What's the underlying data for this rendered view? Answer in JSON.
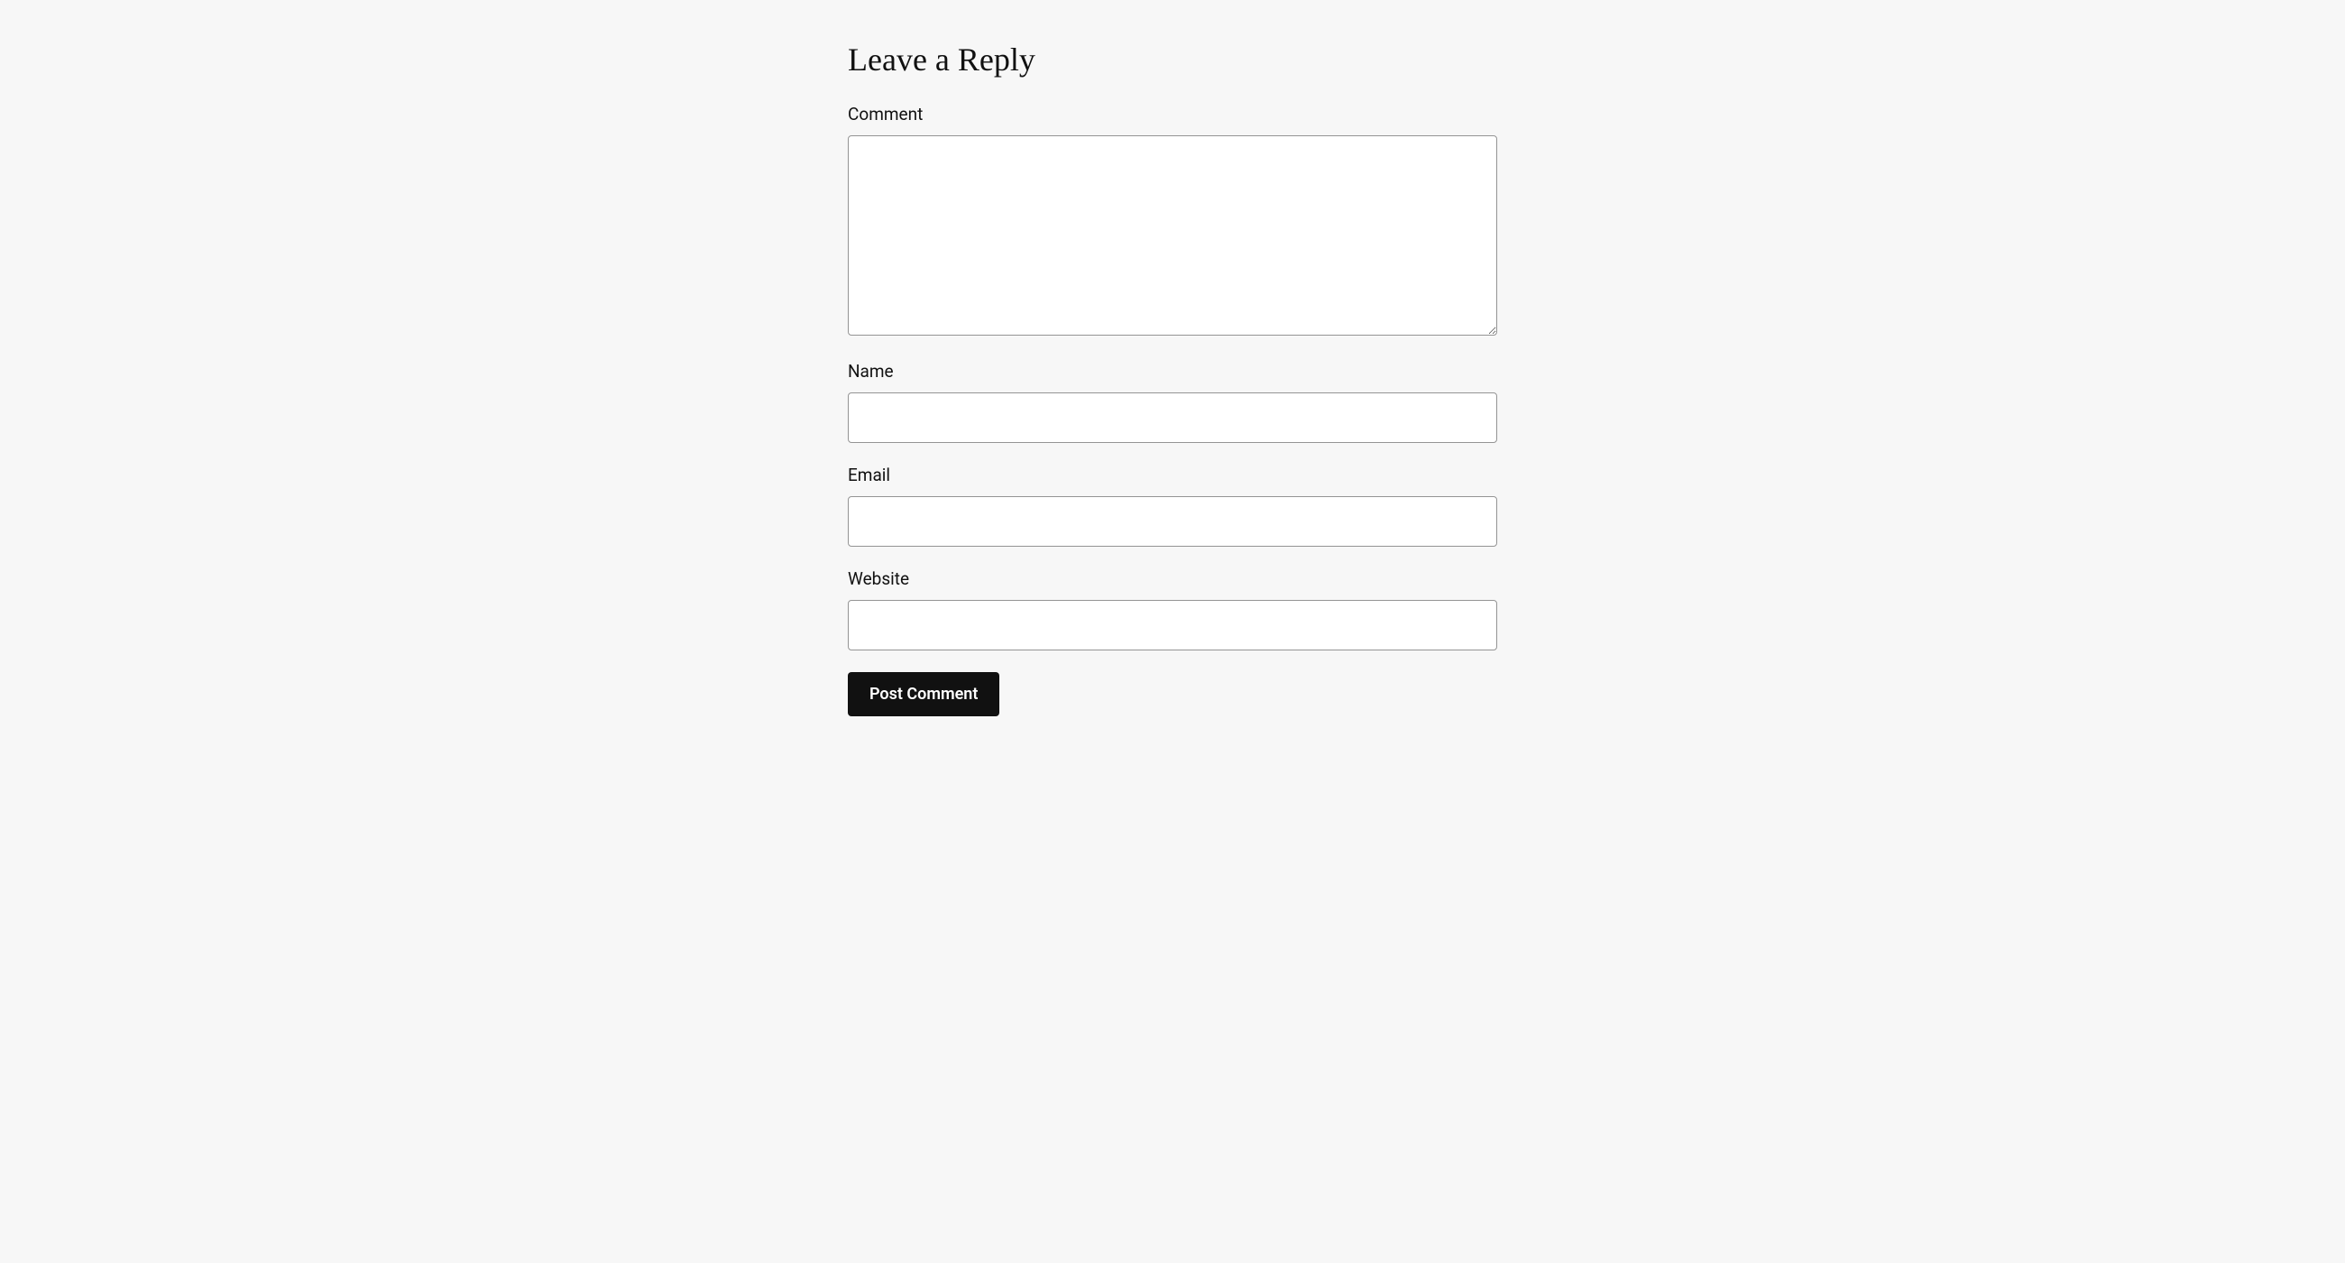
{
  "form": {
    "title": "Leave a Reply",
    "fields": {
      "comment": {
        "label": "Comment",
        "value": ""
      },
      "name": {
        "label": "Name",
        "value": ""
      },
      "email": {
        "label": "Email",
        "value": ""
      },
      "website": {
        "label": "Website",
        "value": ""
      }
    },
    "submit_label": "Post Comment"
  }
}
